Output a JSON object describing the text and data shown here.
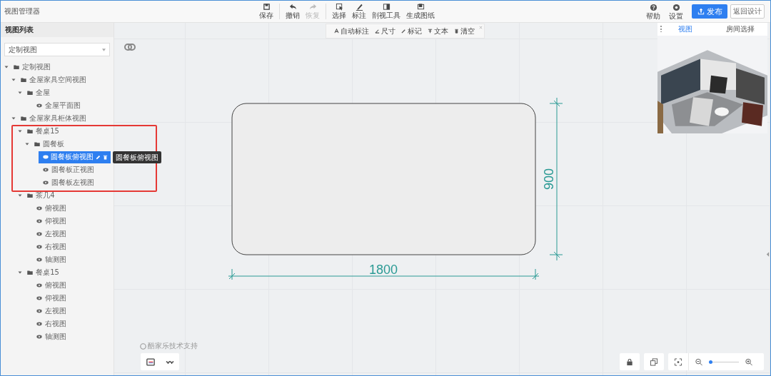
{
  "app": {
    "title": "视图管理器"
  },
  "toolbar_groups": [
    [
      {
        "label": "保存",
        "kind": "save",
        "disabled": false
      }
    ],
    [
      {
        "label": "撤销",
        "kind": "undo",
        "disabled": false
      },
      {
        "label": "恢复",
        "kind": "redo",
        "disabled": true
      }
    ],
    [
      {
        "label": "选择",
        "kind": "select",
        "disabled": false
      },
      {
        "label": "标注",
        "kind": "pen",
        "disabled": false
      },
      {
        "label": "剖视工具",
        "kind": "section",
        "disabled": false
      },
      {
        "label": "生成图纸",
        "kind": "drawing",
        "disabled": false
      }
    ]
  ],
  "header_actions": [
    {
      "label": "帮助",
      "kind": "help"
    },
    {
      "label": "设置",
      "kind": "settings"
    }
  ],
  "publish_button": "发布",
  "back_button": "返回设计",
  "sidebar": {
    "title": "视图列表",
    "select": {
      "value": "定制视图"
    },
    "tree": [
      {
        "label": "定制视图",
        "kind": "folder",
        "expanded": true,
        "children": [
          {
            "label": "全屋家具空间视图",
            "kind": "folder",
            "expanded": true,
            "children": [
              {
                "label": "全屋",
                "kind": "folder",
                "expanded": true,
                "children": [
                  {
                    "label": "全屋平面图",
                    "kind": "view",
                    "selected": false
                  }
                ]
              }
            ]
          },
          {
            "label": "全屋家具柜体视图",
            "kind": "folder",
            "expanded": true,
            "children": [
              {
                "label": "餐桌15",
                "kind": "folder",
                "expanded": true,
                "children": [
                  {
                    "label": "圆餐板",
                    "kind": "folder",
                    "expanded": true,
                    "children": [
                      {
                        "label": "圆餐板俯视图",
                        "kind": "view",
                        "selected": true
                      },
                      {
                        "label": "圆餐板正视图",
                        "kind": "view",
                        "selected": false
                      },
                      {
                        "label": "圆餐板左视图",
                        "kind": "view",
                        "selected": false
                      }
                    ]
                  }
                ]
              },
              {
                "label": "茶几4",
                "kind": "folder",
                "expanded": true,
                "children": [
                  {
                    "label": "俯视图",
                    "kind": "view",
                    "selected": false
                  },
                  {
                    "label": "仰视图",
                    "kind": "view",
                    "selected": false
                  },
                  {
                    "label": "左视图",
                    "kind": "view",
                    "selected": false
                  },
                  {
                    "label": "右视图",
                    "kind": "view",
                    "selected": false
                  },
                  {
                    "label": "轴测图",
                    "kind": "view",
                    "selected": false
                  }
                ]
              },
              {
                "label": "餐桌15",
                "kind": "folder",
                "expanded": true,
                "children": [
                  {
                    "label": "俯视图",
                    "kind": "view",
                    "selected": false
                  },
                  {
                    "label": "仰视图",
                    "kind": "view",
                    "selected": false
                  },
                  {
                    "label": "左视图",
                    "kind": "view",
                    "selected": false
                  },
                  {
                    "label": "右视图",
                    "kind": "view",
                    "selected": false
                  },
                  {
                    "label": "轴测图",
                    "kind": "view",
                    "selected": false
                  }
                ]
              }
            ]
          }
        ]
      }
    ]
  },
  "tooltip": "圆餐板俯视图",
  "annotation_toolbar": [
    {
      "label": "自动标注",
      "kind": "auto"
    },
    {
      "label": "尺寸",
      "kind": "dimension"
    },
    {
      "label": "标记",
      "kind": "mark"
    },
    {
      "label": "文本",
      "kind": "text"
    },
    {
      "label": "清空",
      "kind": "clear"
    }
  ],
  "minimap": {
    "tabs": [
      {
        "label": "视图",
        "selected": true
      },
      {
        "label": "房间选择",
        "selected": false
      }
    ]
  },
  "drawing": {
    "width_label": "1800",
    "height_label": "900"
  },
  "credit": "酷家乐技术支持",
  "zoom": {
    "level": 0.05
  }
}
